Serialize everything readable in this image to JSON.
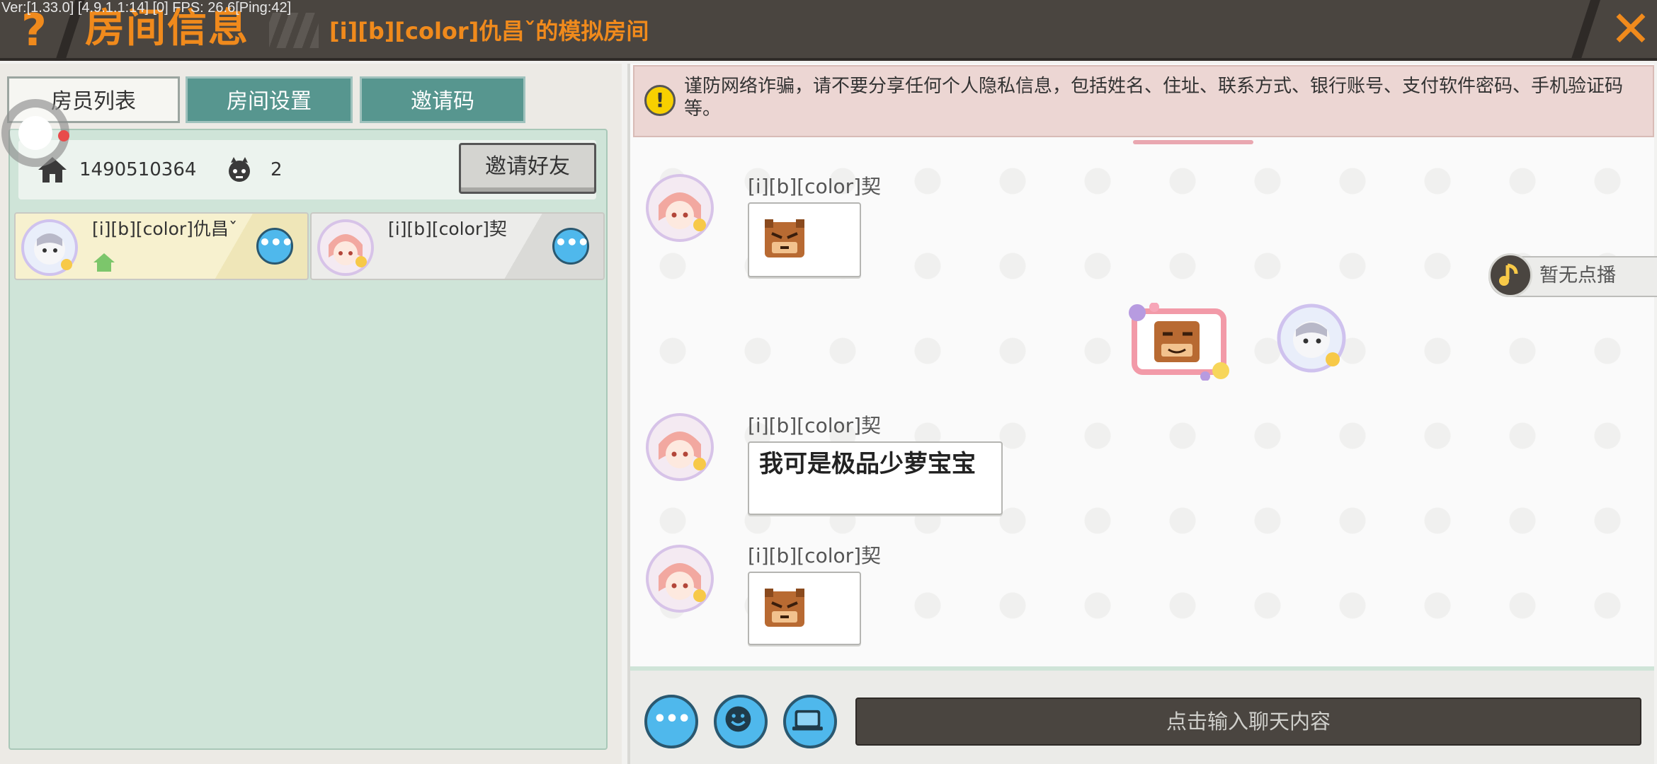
{
  "debug_overlay": "Ver:[1.33.0] [4.9.1.1:14] [0] FPS: 26.6[Ping:42]",
  "header": {
    "help_icon": "?",
    "title": "房间信息",
    "room_name": "[i][b][color]仇昌ˇ的模拟房间",
    "close_icon": "✕"
  },
  "tabs": [
    {
      "label": "房员列表",
      "active": true
    },
    {
      "label": "房间设置",
      "active": false
    },
    {
      "label": "邀请码",
      "active": false
    }
  ],
  "room": {
    "room_id": "1490510364",
    "member_count": "2",
    "invite_button": "邀请好友"
  },
  "members": [
    {
      "name": "[i][b][color]仇昌ˇ",
      "is_host": true,
      "more_icon": "•••"
    },
    {
      "name": "[i][b][color]契",
      "is_host": false,
      "more_icon": "•••"
    }
  ],
  "notice": {
    "text": "谨防网络诈骗，请不要分享任何个人隐私信息，包括姓名、住址、联系方式、银行账号、支付软件密码、手机验证码等。",
    "icon": "!"
  },
  "messages": [
    {
      "sender": "[i][b][color]契",
      "type": "emoji",
      "emoji": "angry-bear-icon"
    },
    {
      "sender": "self",
      "type": "emoji",
      "emoji": "smug-bear-icon"
    },
    {
      "sender": "[i][b][color]契",
      "type": "text",
      "text": "我可是极品少萝宝宝"
    },
    {
      "sender": "[i][b][color]契",
      "type": "emoji",
      "emoji": "angry-bear-icon"
    }
  ],
  "music": {
    "label": "暂无点播"
  },
  "input": {
    "placeholder": "点击输入聊天内容",
    "more_icon": "•••"
  },
  "colors": {
    "accent_orange": "#f08a1c",
    "header_bg": "#4a4540",
    "tab_teal": "#57968f",
    "member_panel": "#cfe4d8",
    "round_button_blue": "#4fb8ec",
    "notice_bg": "#ecd6d3"
  }
}
